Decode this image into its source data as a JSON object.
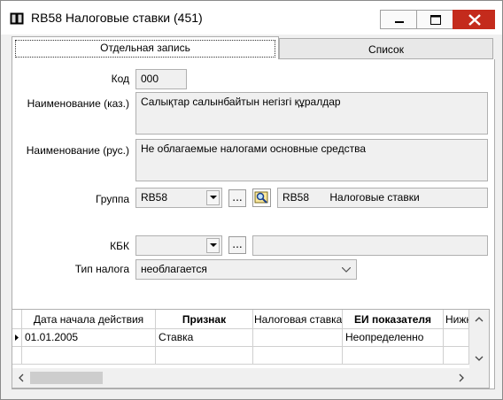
{
  "window": {
    "title": "RB58 Налоговые ставки (451)",
    "close_color": "#c42b1c"
  },
  "tabs": [
    {
      "label": "Отдельная запись",
      "active": true
    },
    {
      "label": "Список",
      "active": false
    }
  ],
  "form": {
    "code_label": "Код",
    "code_value": "000",
    "name_kaz_label": "Наименование (каз.)",
    "name_kaz_value": "Салықтар салынбайтын негізгі құралдар",
    "name_rus_label": "Наименование (рус.)",
    "name_rus_value": "Не облагаемые налогами основные средства",
    "group_label": "Группа",
    "group_value": "RB58",
    "group_browse": "...",
    "group_code": "RB58",
    "group_name": "Налоговые ставки",
    "kbk_label": "КБК",
    "kbk_value": "",
    "kbk_browse": "...",
    "kbk_desc": "",
    "tax_type_label": "Тип налога",
    "tax_type_value": "необлагается"
  },
  "grid": {
    "columns": [
      {
        "label": "Дата начала действия",
        "bold": false
      },
      {
        "label": "Признак",
        "bold": true
      },
      {
        "label": "Налоговая ставка",
        "bold": false
      },
      {
        "label": "ЕИ показателя",
        "bold": true
      },
      {
        "label": "Нижн",
        "bold": false
      }
    ],
    "rows": [
      {
        "cells": [
          "01.01.2005",
          "Ставка",
          "",
          "Неопределенно",
          ""
        ],
        "current": true
      },
      {
        "cells": [
          "",
          "",
          "",
          "",
          ""
        ],
        "current": false
      }
    ]
  }
}
